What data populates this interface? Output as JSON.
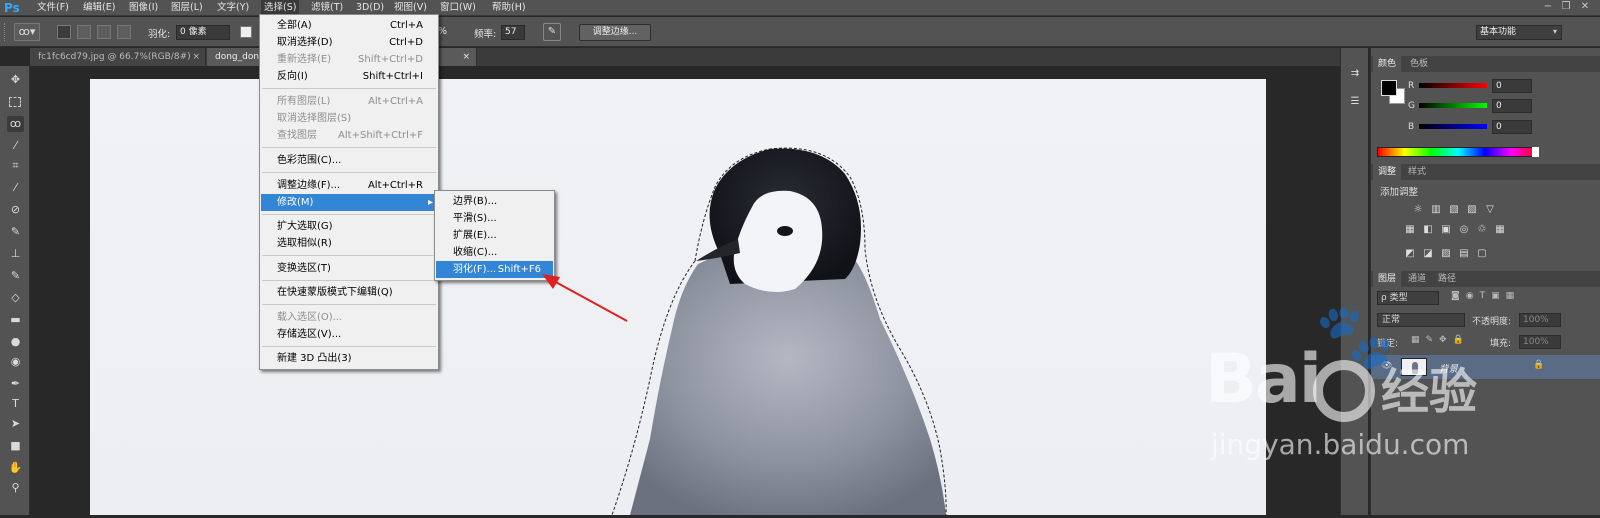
{
  "app": {
    "logo": "Ps"
  },
  "menubar": {
    "items": [
      "文件(F)",
      "编辑(E)",
      "图像(I)",
      "图层(L)",
      "文字(Y)",
      "选择(S)",
      "滤镜(T)",
      "3D(D)",
      "视图(V)",
      "窗口(W)",
      "帮助(H)"
    ],
    "active_index": 5
  },
  "window_controls": {
    "minimize": "−",
    "restore": "❐",
    "close": "✕"
  },
  "options": {
    "feather_label": "羽化:",
    "feather_value": "0 像素",
    "percent_fragment": "%",
    "frequency_label": "频率:",
    "frequency_value": "57",
    "refine_edge_button": "调整边缘...",
    "workspace": "基本功能"
  },
  "tabs": [
    {
      "label": "fc1fc6cd79.jpg @ 66.7%(RGB/8#)",
      "close": "×"
    },
    {
      "label": "dong_don",
      "close": "×"
    }
  ],
  "select_menu": {
    "items": [
      {
        "label": "全部(A)",
        "shortcut": "Ctrl+A",
        "disabled": false
      },
      {
        "label": "取消选择(D)",
        "shortcut": "Ctrl+D",
        "disabled": false
      },
      {
        "label": "重新选择(E)",
        "shortcut": "Shift+Ctrl+D",
        "disabled": true
      },
      {
        "label": "反向(I)",
        "shortcut": "Shift+Ctrl+I",
        "disabled": false
      },
      {
        "label": "所有图层(L)",
        "shortcut": "Alt+Ctrl+A",
        "disabled": true
      },
      {
        "label": "取消选择图层(S)",
        "shortcut": "",
        "disabled": true
      },
      {
        "label": "查找图层",
        "shortcut": "Alt+Shift+Ctrl+F",
        "disabled": true
      },
      {
        "label": "色彩范围(C)...",
        "shortcut": "",
        "disabled": false
      },
      {
        "label": "调整边缘(F)...",
        "shortcut": "Alt+Ctrl+R",
        "disabled": false
      },
      {
        "label": "修改(M)",
        "shortcut": "",
        "disabled": false,
        "highlighted": true
      },
      {
        "label": "扩大选取(G)",
        "shortcut": "",
        "disabled": false
      },
      {
        "label": "选取相似(R)",
        "shortcut": "",
        "disabled": false
      },
      {
        "label": "变换选区(T)",
        "shortcut": "",
        "disabled": false
      },
      {
        "label": "在快速蒙版模式下编辑(Q)",
        "shortcut": "",
        "disabled": false
      },
      {
        "label": "载入选区(O)...",
        "shortcut": "",
        "disabled": true
      },
      {
        "label": "存储选区(V)...",
        "shortcut": "",
        "disabled": false
      },
      {
        "label": "新建 3D 凸出(3)",
        "shortcut": "",
        "disabled": false
      }
    ]
  },
  "modify_submenu": {
    "items": [
      {
        "label": "边界(B)...",
        "shortcut": ""
      },
      {
        "label": "平滑(S)...",
        "shortcut": ""
      },
      {
        "label": "扩展(E)...",
        "shortcut": ""
      },
      {
        "label": "收缩(C)...",
        "shortcut": ""
      },
      {
        "label": "羽化(F)...",
        "shortcut": "Shift+F6",
        "highlighted": true
      }
    ]
  },
  "color_panel": {
    "tabs": [
      "颜色",
      "色板"
    ],
    "r_label": "R",
    "g_label": "G",
    "b_label": "B",
    "r_value": "0",
    "g_value": "0",
    "b_value": "0"
  },
  "adjust_panel": {
    "tabs": [
      "调整",
      "样式"
    ],
    "title": "添加调整"
  },
  "layers_panel": {
    "tabs": [
      "图层",
      "通道",
      "路径"
    ],
    "kind": "ρ 类型",
    "blend_mode": "正常",
    "opacity_label": "不透明度:",
    "opacity_value": "100%",
    "lock_label": "锁定:",
    "fill_label": "填充:",
    "fill_value": "100%",
    "layer_name": "背景"
  },
  "watermark": {
    "brand": "Bai",
    "brand2": "经验",
    "url": "jingyan.baidu.com"
  }
}
